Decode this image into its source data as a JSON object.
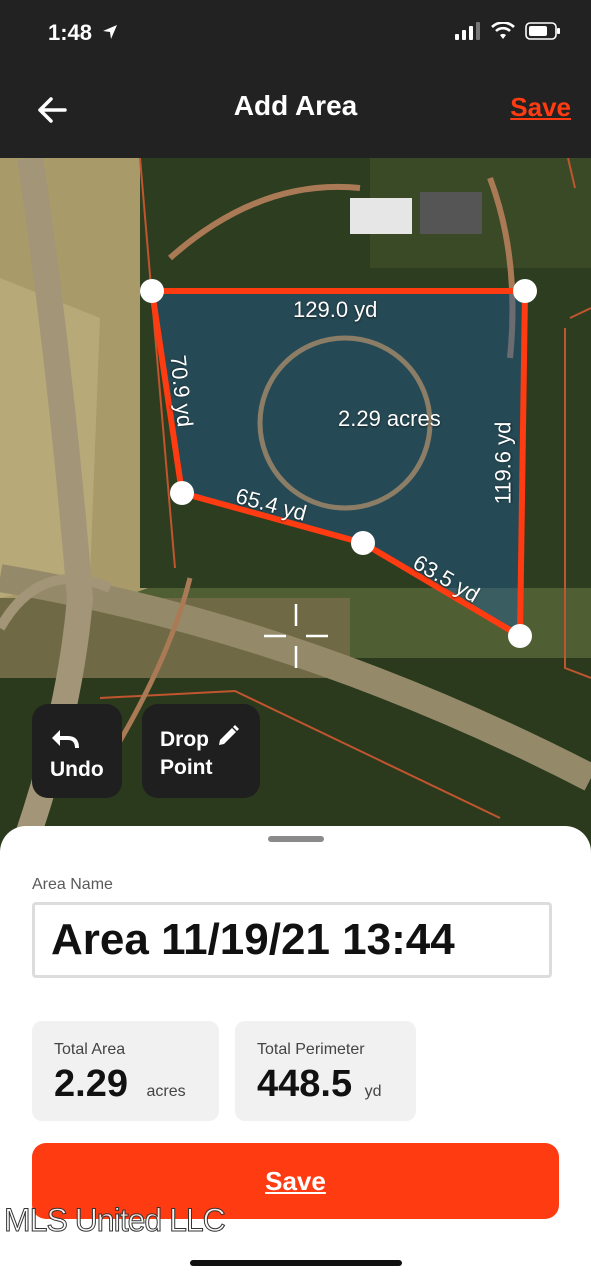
{
  "status_bar": {
    "time": "1:48"
  },
  "header": {
    "title": "Add Area",
    "save_label": "Save"
  },
  "map": {
    "segment_labels": {
      "top": "129.0 yd",
      "left": "70.9 yd",
      "right": "119.6 yd",
      "bottom_left": "65.4 yd",
      "bottom_right": "63.5 yd"
    },
    "area_label": "2.29 acres",
    "undo_label": "Undo",
    "drop_point_label_1": "Drop",
    "drop_point_label_2": "Point",
    "polygon_color": "#ff3b12"
  },
  "sheet": {
    "area_name_label": "Area Name",
    "area_name_value": "Area 11/19/21 13:44",
    "total_area_label": "Total Area",
    "total_area_value": "2.29",
    "total_area_unit": "acres",
    "total_perimeter_label": "Total Perimeter",
    "total_perimeter_value": "448.5",
    "total_perimeter_unit": "yd",
    "save_label": "Save"
  },
  "watermark": "MLS United LLC"
}
